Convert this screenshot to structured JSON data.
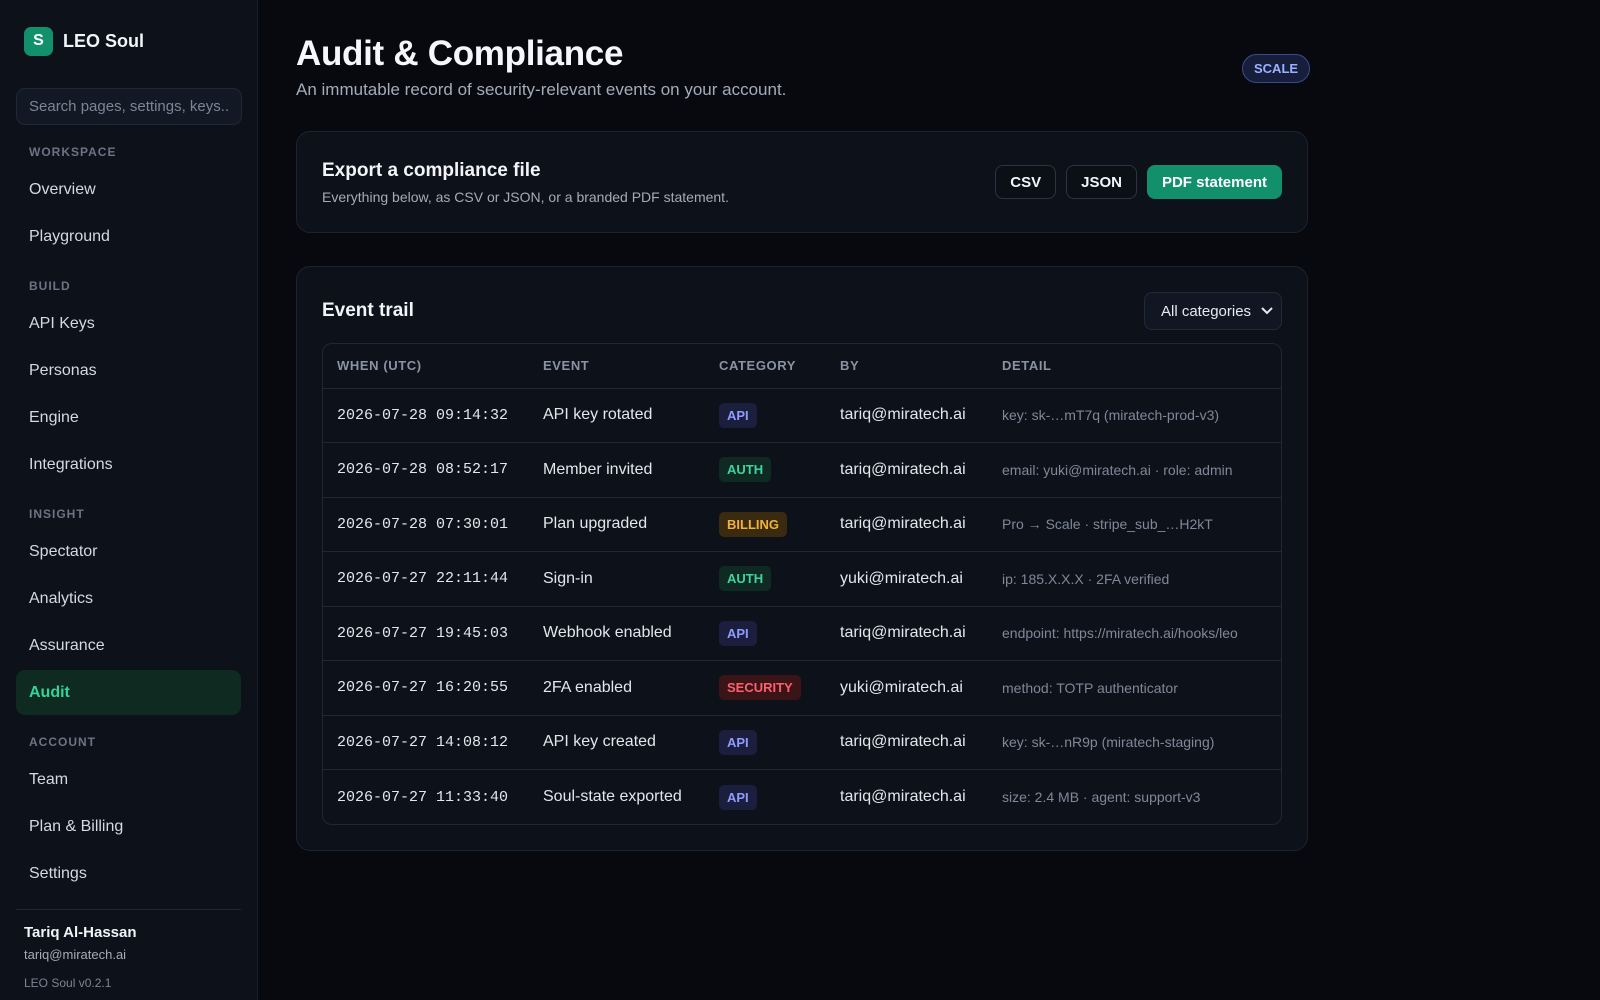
{
  "app": {
    "logo_letter": "S",
    "name": "LEO Soul",
    "version": "LEO Soul v0.2.1"
  },
  "search": {
    "placeholder": "Search pages, settings, keys..."
  },
  "sidebar": {
    "sections": [
      {
        "heading": "WORKSPACE",
        "items": [
          "Overview",
          "Playground"
        ]
      },
      {
        "heading": "BUILD",
        "items": [
          "API Keys",
          "Personas",
          "Engine",
          "Integrations"
        ]
      },
      {
        "heading": "INSIGHT",
        "items": [
          "Spectator",
          "Analytics",
          "Assurance",
          "Audit"
        ]
      },
      {
        "heading": "ACCOUNT",
        "items": [
          "Team",
          "Plan & Billing",
          "Settings"
        ]
      }
    ],
    "active_item": "Audit"
  },
  "user": {
    "name": "Tariq Al-Hassan",
    "email": "tariq@miratech.ai"
  },
  "page": {
    "title": "Audit & Compliance",
    "subtitle": "An immutable record of security-relevant events on your account.",
    "plan_badge": "SCALE"
  },
  "export": {
    "title": "Export a compliance file",
    "description": "Everything below, as CSV or JSON, or a branded PDF statement.",
    "csv_label": "CSV",
    "json_label": "JSON",
    "pdf_label": "PDF statement"
  },
  "trail": {
    "title": "Event trail",
    "filter_value": "All categories",
    "columns": [
      "WHEN (UTC)",
      "EVENT",
      "CATEGORY",
      "BY",
      "DETAIL"
    ],
    "rows": [
      {
        "when": "2026-07-28 09:14:32",
        "event": "API key rotated",
        "category": "API",
        "by": "tariq@miratech.ai",
        "detail": "key: sk-…mT7q (miratech-prod-v3)"
      },
      {
        "when": "2026-07-28 08:52:17",
        "event": "Member invited",
        "category": "AUTH",
        "by": "tariq@miratech.ai",
        "detail": "email: yuki@miratech.ai · role: admin"
      },
      {
        "when": "2026-07-28 07:30:01",
        "event": "Plan upgraded",
        "category": "BILLING",
        "by": "tariq@miratech.ai",
        "detail": "Pro → Scale · stripe_sub_…H2kT"
      },
      {
        "when": "2026-07-27 22:11:44",
        "event": "Sign-in",
        "category": "AUTH",
        "by": "yuki@miratech.ai",
        "detail": "ip: 185.X.X.X · 2FA verified"
      },
      {
        "when": "2026-07-27 19:45:03",
        "event": "Webhook enabled",
        "category": "API",
        "by": "tariq@miratech.ai",
        "detail": "endpoint: https://miratech.ai/hooks/leo"
      },
      {
        "when": "2026-07-27 16:20:55",
        "event": "2FA enabled",
        "category": "SECURITY",
        "by": "yuki@miratech.ai",
        "detail": "method: TOTP authenticator"
      },
      {
        "when": "2026-07-27 14:08:12",
        "event": "API key created",
        "category": "API",
        "by": "tariq@miratech.ai",
        "detail": "key: sk-…nR9p (miratech-staging)"
      },
      {
        "when": "2026-07-27 11:33:40",
        "event": "Soul-state exported",
        "category": "API",
        "by": "tariq@miratech.ai",
        "detail": "size: 2.4 MB · agent: support-v3"
      }
    ]
  }
}
